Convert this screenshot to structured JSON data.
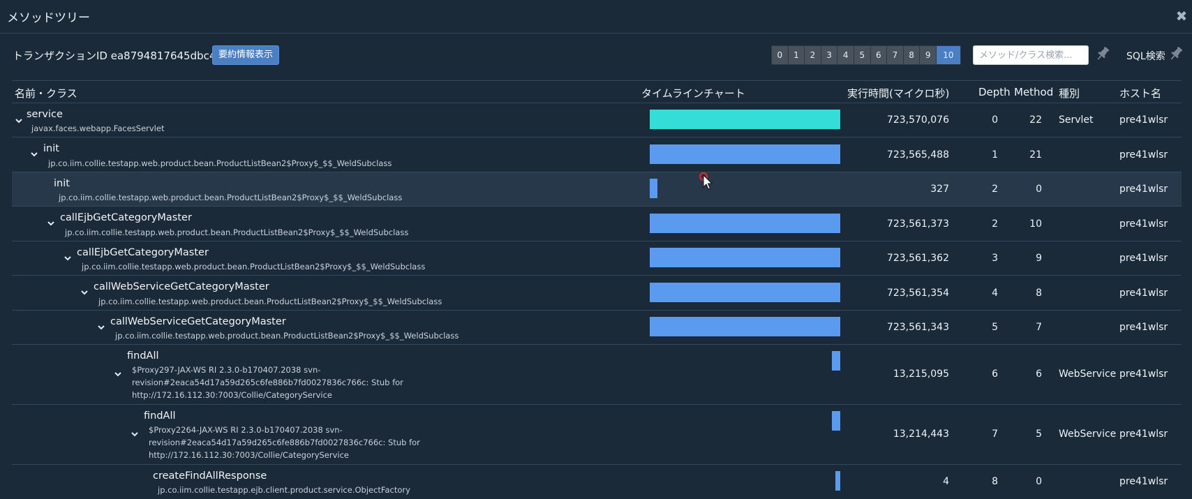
{
  "window": {
    "title": "メソッドツリー",
    "close_label": "✖"
  },
  "toolbar": {
    "transaction_label": "トランザクションID ea8794817645dbc4",
    "summary_button": "要約情報表示",
    "depth_buttons": [
      "0",
      "1",
      "2",
      "3",
      "4",
      "5",
      "6",
      "7",
      "8",
      "9",
      "10"
    ],
    "active_depth": "10",
    "search_placeholder": "メソッド/クラス検索...",
    "sql_search_label": "SQL検索"
  },
  "columns": {
    "name": "名前・クラス",
    "timeline": "タイムラインチャート",
    "exec_time": "実行時間(マイクロ秒)",
    "depth": "Depth",
    "method": "Method",
    "type": "種別",
    "host": "ホスト名"
  },
  "colors": {
    "root_bar": "#35ddd8",
    "bar": "#5b9bef",
    "accent": "#4a7fc4"
  },
  "rows": [
    {
      "name": "service",
      "class_lines": [
        "javax.faces.webapp.FacesServlet"
      ],
      "time": "723,570,076",
      "depth": "0",
      "method": "22",
      "type": "Servlet",
      "host": "pre41wlsr"
    },
    {
      "name": "init",
      "class_lines": [
        "jp.co.iim.collie.testapp.web.product.bean.ProductListBean2$Proxy$_$$_WeldSubclass"
      ],
      "time": "723,565,488",
      "depth": "1",
      "method": "21",
      "type": "",
      "host": "pre41wlsr"
    },
    {
      "name": "init",
      "class_lines": [
        "jp.co.iim.collie.testapp.web.product.bean.ProductListBean2$Proxy$_$$_WeldSubclass"
      ],
      "time": "327",
      "depth": "2",
      "method": "0",
      "type": "",
      "host": "pre41wlsr"
    },
    {
      "name": "callEjbGetCategoryMaster",
      "class_lines": [
        "jp.co.iim.collie.testapp.web.product.bean.ProductListBean2$Proxy$_$$_WeldSubclass"
      ],
      "time": "723,561,373",
      "depth": "2",
      "method": "10",
      "type": "",
      "host": "pre41wlsr"
    },
    {
      "name": "callEjbGetCategoryMaster",
      "class_lines": [
        "jp.co.iim.collie.testapp.web.product.bean.ProductListBean2$Proxy$_$$_WeldSubclass"
      ],
      "time": "723,561,362",
      "depth": "3",
      "method": "9",
      "type": "",
      "host": "pre41wlsr"
    },
    {
      "name": "callWebServiceGetCategoryMaster",
      "class_lines": [
        "jp.co.iim.collie.testapp.web.product.bean.ProductListBean2$Proxy$_$$_WeldSubclass"
      ],
      "time": "723,561,354",
      "depth": "4",
      "method": "8",
      "type": "",
      "host": "pre41wlsr"
    },
    {
      "name": "callWebServiceGetCategoryMaster",
      "class_lines": [
        "jp.co.iim.collie.testapp.web.product.bean.ProductListBean2$Proxy$_$$_WeldSubclass"
      ],
      "time": "723,561,343",
      "depth": "5",
      "method": "7",
      "type": "",
      "host": "pre41wlsr"
    },
    {
      "name": "findAll",
      "class_lines": [
        "$Proxy297-JAX-WS RI 2.3.0-b170407.2038 svn-",
        "revision#2eaca54d17a59d265c6fe886b7fd0027836c766c: Stub for",
        "http://172.16.112.30:7003/Collie/CategoryService"
      ],
      "time": "13,215,095",
      "depth": "6",
      "method": "6",
      "type": "WebService",
      "host": "pre41wlsr"
    },
    {
      "name": "findAll",
      "class_lines": [
        "$Proxy2264-JAX-WS RI 2.3.0-b170407.2038 svn-",
        "revision#2eaca54d17a59d265c6fe886b7fd0027836c766c: Stub for",
        "http://172.16.112.30:7003/Collie/CategoryService"
      ],
      "time": "13,214,443",
      "depth": "7",
      "method": "5",
      "type": "WebService",
      "host": "pre41wlsr"
    },
    {
      "name": "createFindAllResponse",
      "class_lines": [
        "jp.co.iim.collie.testapp.ejb.client.product.service.ObjectFactory"
      ],
      "time": "4",
      "depth": "8",
      "method": "0",
      "type": "",
      "host": "pre41wlsr"
    }
  ]
}
